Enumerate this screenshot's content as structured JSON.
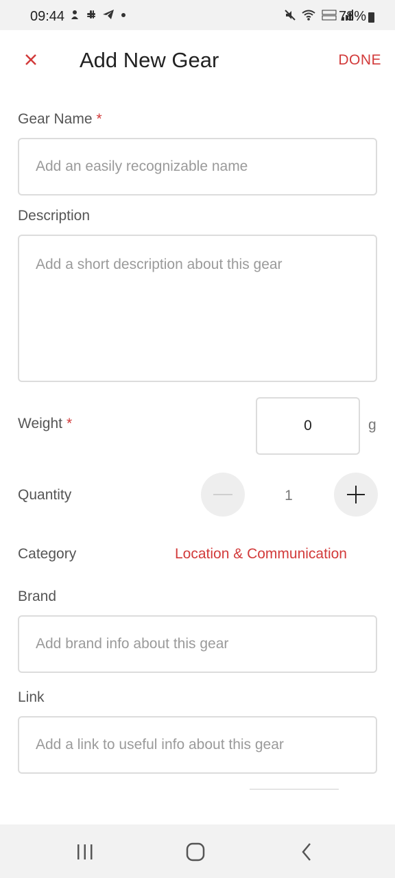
{
  "status_bar": {
    "time": "09:44",
    "left_icons": [
      "notification-icon",
      "slack-icon",
      "telegram-icon",
      "dot-icon"
    ],
    "right_icons": [
      "mute-icon",
      "wifi-icon",
      "volte-icon",
      "signal-icon"
    ],
    "battery": "78%"
  },
  "header": {
    "title": "Add New Gear",
    "done_label": "DONE",
    "accent_color": "#d23a3a"
  },
  "form": {
    "gear_name": {
      "label": "Gear Name",
      "required_mark": "*",
      "placeholder": "Add an easily recognizable name",
      "value": ""
    },
    "description": {
      "label": "Description",
      "placeholder": "Add a short description about this gear",
      "value": ""
    },
    "weight": {
      "label": "Weight",
      "required_mark": "*",
      "value": "0",
      "unit": "g"
    },
    "quantity": {
      "label": "Quantity",
      "value": "1"
    },
    "category": {
      "label": "Category",
      "value": "Location & Communication"
    },
    "brand": {
      "label": "Brand",
      "placeholder": "Add brand info about this gear",
      "value": ""
    },
    "link": {
      "label": "Link",
      "placeholder": "Add a link to useful info about this gear",
      "value": ""
    }
  },
  "nav_bar": {
    "buttons": [
      "recents-icon",
      "home-icon",
      "back-icon"
    ]
  }
}
